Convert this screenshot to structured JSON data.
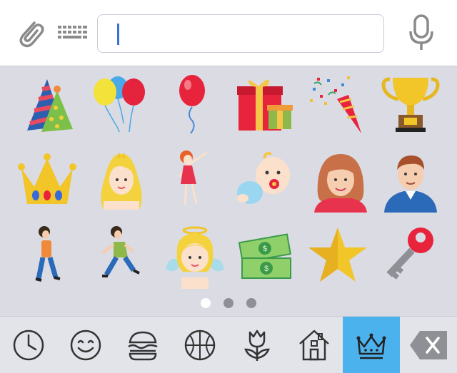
{
  "toolbar": {
    "attach_icon": "paperclip-icon",
    "keyboard_icon": "keyboard-icon",
    "mic_icon": "microphone-icon",
    "input_value": ""
  },
  "stickers": [
    "party-hats",
    "balloons",
    "red-balloon",
    "gift-boxes",
    "party-popper",
    "trophy",
    "golden-crown",
    "princess",
    "dancing-woman",
    "baby-with-pacifier",
    "woman-portrait",
    "man-portrait",
    "walking-boy",
    "running-boy",
    "angel",
    "money",
    "gold-star",
    "red-key"
  ],
  "pagination": {
    "pages": 3,
    "current": 1
  },
  "categories": [
    {
      "icon": "clock-icon",
      "active": false
    },
    {
      "icon": "smiley-icon",
      "active": false
    },
    {
      "icon": "burger-icon",
      "active": false
    },
    {
      "icon": "basketball-icon",
      "active": false
    },
    {
      "icon": "tulip-icon",
      "active": false
    },
    {
      "icon": "house-icon",
      "active": false
    },
    {
      "icon": "crown-icon",
      "active": true
    },
    {
      "icon": "backspace-icon",
      "active": false
    }
  ],
  "colors": {
    "accent": "#4cb2ee",
    "panel": "#dadbe3",
    "caret": "#3a6fe0"
  }
}
